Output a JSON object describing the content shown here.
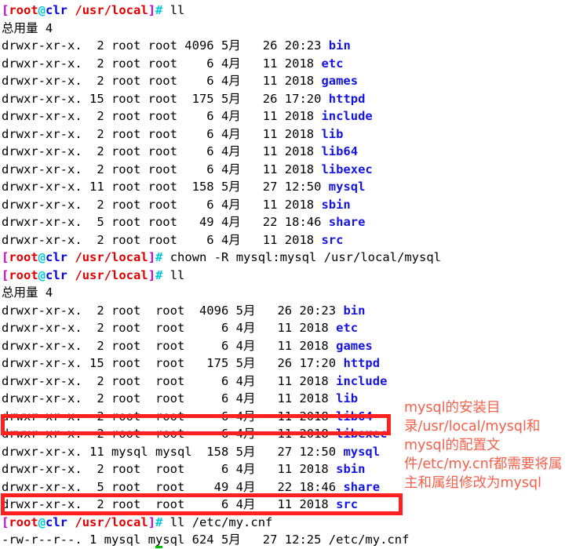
{
  "terminal": {
    "prompt": {
      "bracket_open": "[",
      "user": "root",
      "at": "@",
      "host": "clr",
      "space": " ",
      "path": "/usr/local",
      "bracket_close": "]",
      "hash": "#"
    },
    "lines": [
      {
        "type": "command",
        "command": " ll"
      },
      {
        "type": "output",
        "text": "总用量 4"
      },
      {
        "type": "listing",
        "text": "drwxr-xr-x.  2 root root 4096 5月   26 20:23 ",
        "name": "bin"
      },
      {
        "type": "listing",
        "text": "drwxr-xr-x.  2 root root    6 4月   11 2018 ",
        "name": "etc"
      },
      {
        "type": "listing",
        "text": "drwxr-xr-x.  2 root root    6 4月   11 2018 ",
        "name": "games"
      },
      {
        "type": "listing",
        "text": "drwxr-xr-x. 15 root root  175 5月   26 17:20 ",
        "name": "httpd"
      },
      {
        "type": "listing",
        "text": "drwxr-xr-x.  2 root root    6 4月   11 2018 ",
        "name": "include"
      },
      {
        "type": "listing",
        "text": "drwxr-xr-x.  2 root root    6 4月   11 2018 ",
        "name": "lib"
      },
      {
        "type": "listing",
        "text": "drwxr-xr-x.  2 root root    6 4月   11 2018 ",
        "name": "lib64"
      },
      {
        "type": "listing",
        "text": "drwxr-xr-x.  2 root root    6 4月   11 2018 ",
        "name": "libexec"
      },
      {
        "type": "listing",
        "text": "drwxr-xr-x. 11 root root  158 5月   27 12:50 ",
        "name": "mysql"
      },
      {
        "type": "listing",
        "text": "drwxr-xr-x.  2 root root    6 4月   11 2018 ",
        "name": "sbin"
      },
      {
        "type": "listing",
        "text": "drwxr-xr-x.  5 root root   49 4月   22 18:46 ",
        "name": "share"
      },
      {
        "type": "listing",
        "text": "drwxr-xr-x.  2 root root    6 4月   11 2018 ",
        "name": "src"
      },
      {
        "type": "command",
        "command": " chown -R mysql:mysql /usr/local/mysql"
      },
      {
        "type": "command",
        "command": " ll"
      },
      {
        "type": "output",
        "text": "总用量 4"
      },
      {
        "type": "listing",
        "text": "drwxr-xr-x.  2 root  root  4096 5月   26 20:23 ",
        "name": "bin"
      },
      {
        "type": "listing",
        "text": "drwxr-xr-x.  2 root  root     6 4月   11 2018 ",
        "name": "etc"
      },
      {
        "type": "listing",
        "text": "drwxr-xr-x.  2 root  root     6 4月   11 2018 ",
        "name": "games"
      },
      {
        "type": "listing",
        "text": "drwxr-xr-x. 15 root  root   175 5月   26 17:20 ",
        "name": "httpd"
      },
      {
        "type": "listing",
        "text": "drwxr-xr-x.  2 root  root     6 4月   11 2018 ",
        "name": "include"
      },
      {
        "type": "listing",
        "text": "drwxr-xr-x.  2 root  root     6 4月   11 2018 ",
        "name": "lib"
      },
      {
        "type": "listing",
        "text": "drwxr-xr-x.  2 root  root     6 4月   11 2018 ",
        "name": "lib64"
      },
      {
        "type": "listing",
        "text": "drwxr-xr-x.  2 root  root     6 4月   11 2018 ",
        "name": "libexec"
      },
      {
        "type": "listing",
        "text": "drwxr-xr-x. 11 mysql mysql  158 5月   27 12:50 ",
        "name": "mysql",
        "highlighted": true
      },
      {
        "type": "listing",
        "text": "drwxr-xr-x.  2 root  root     6 4月   11 2018 ",
        "name": "sbin"
      },
      {
        "type": "listing",
        "text": "drwxr-xr-x.  5 root  root    49 4月   22 18:46 ",
        "name": "share"
      },
      {
        "type": "listing",
        "text": "drwxr-xr-x.  2 root  root     6 4月   11 2018 ",
        "name": "src"
      },
      {
        "type": "command",
        "command": " ll /etc/my.cnf"
      },
      {
        "type": "file",
        "text": "-rw-r--r--. 1 mysql mysql 624 5月   27 12:25 /etc/my.cnf",
        "highlighted": true,
        "cursor": true
      }
    ]
  },
  "annotation": {
    "text": "mysql的安装目录/usr/local/mysql和mysql的配置文件/etc/my.cnf都需要将属主和属组修改为mysql",
    "color": "#f4604a"
  },
  "highlight": {
    "color": "#ff2020"
  }
}
